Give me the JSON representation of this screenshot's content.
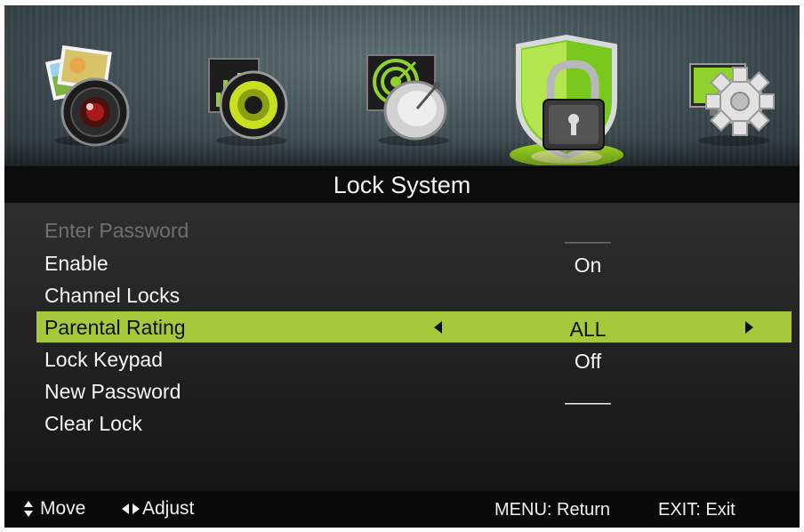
{
  "tabs": [
    {
      "id": "picture",
      "icon": "picture-camera-icon",
      "selected": false
    },
    {
      "id": "sound",
      "icon": "sound-speaker-icon",
      "selected": false
    },
    {
      "id": "channel",
      "icon": "channel-satellite-icon",
      "selected": false
    },
    {
      "id": "lock",
      "icon": "lock-shield-icon",
      "selected": true
    },
    {
      "id": "setup",
      "icon": "setup-gear-icon",
      "selected": false
    }
  ],
  "title": "Lock System",
  "menu": {
    "items": [
      {
        "label": "Enter Password",
        "value": "____",
        "state": "disabled"
      },
      {
        "label": "Enable",
        "value": "On",
        "state": "normal"
      },
      {
        "label": "Channel Locks",
        "value": "",
        "state": "normal"
      },
      {
        "label": "Parental Rating",
        "value": "ALL",
        "state": "selected"
      },
      {
        "label": "Lock Keypad",
        "value": "Off",
        "state": "normal"
      },
      {
        "label": "New Password",
        "value": "____",
        "state": "normal"
      },
      {
        "label": "Clear Lock",
        "value": "",
        "state": "normal"
      }
    ]
  },
  "footer": {
    "move": "Move",
    "adjust": "Adjust",
    "menu_hint": "MENU: Return",
    "exit_hint": "EXIT: Exit"
  },
  "colors": {
    "selected_row": "#a6c93b",
    "accent_green": "#8fd22c",
    "disabled_text": "#6f6f6f"
  }
}
